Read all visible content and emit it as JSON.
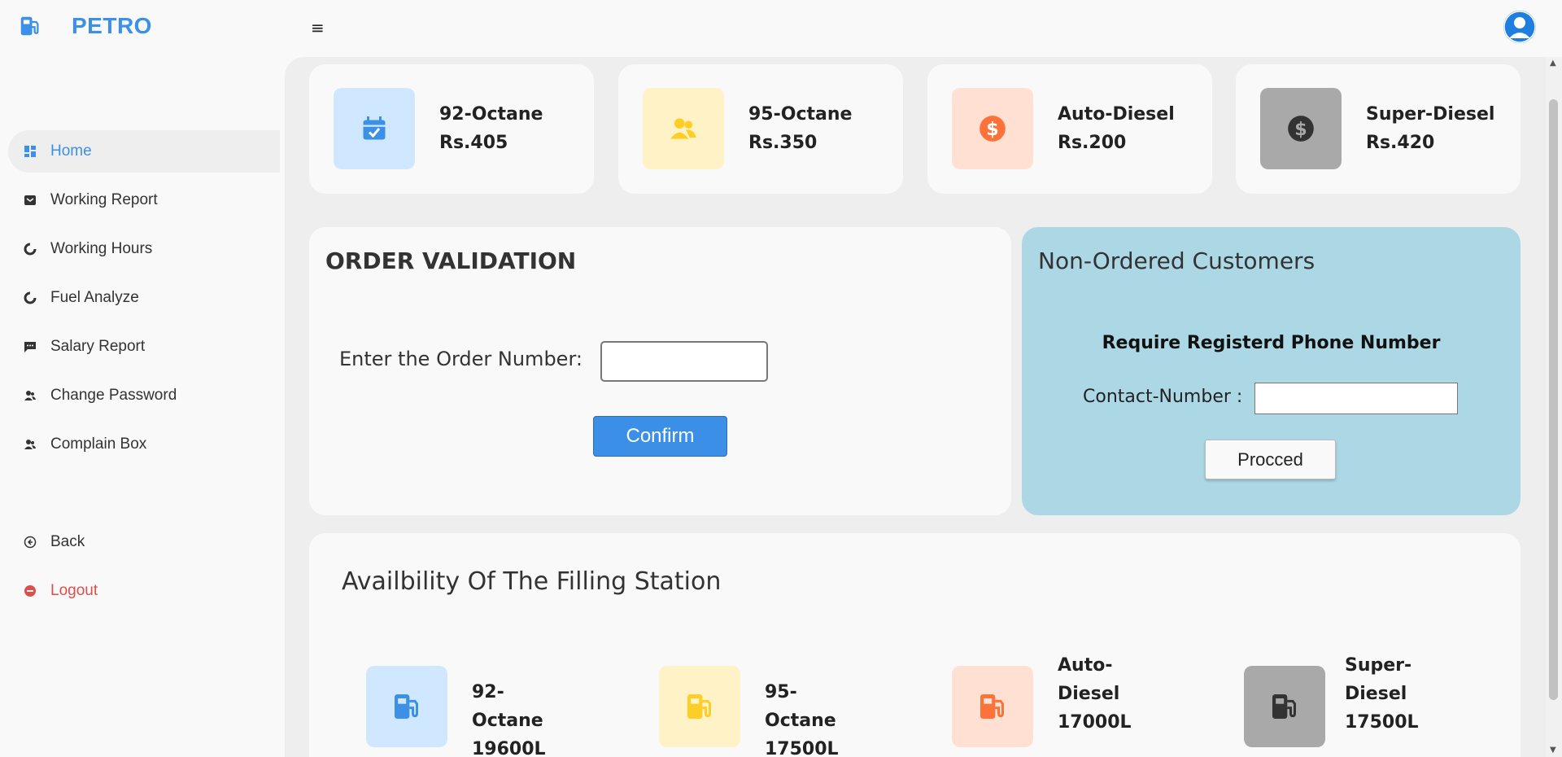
{
  "brand": {
    "name": "PETRO",
    "color": "#3c91e6"
  },
  "header": {
    "menu_icon": "hamburger-icon",
    "avatar_icon": "user-avatar-icon"
  },
  "sidebar": {
    "items": [
      {
        "label": "Home",
        "icon": "dashboard-icon",
        "active": true
      },
      {
        "label": "Working Report",
        "icon": "inbox-icon"
      },
      {
        "label": "Working Hours",
        "icon": "pie-chart-icon"
      },
      {
        "label": "Fuel Analyze",
        "icon": "pie-chart-icon"
      },
      {
        "label": "Salary Report",
        "icon": "message-icon"
      },
      {
        "label": "Change Password",
        "icon": "user-group-icon"
      },
      {
        "label": "Complain Box",
        "icon": "user-group-icon"
      }
    ],
    "back": {
      "label": "Back",
      "icon": "arrow-left-circle-icon"
    },
    "logout": {
      "label": "Logout",
      "icon": "logout-icon",
      "color": "#db504a"
    }
  },
  "prices": [
    {
      "name": "92-Octane",
      "price": "Rs.405",
      "icon": "calendar-check-icon",
      "bg": "#cfe8ff",
      "fg": "#3c91e6"
    },
    {
      "name": "95-Octane",
      "price": "Rs.350",
      "icon": "group-icon",
      "bg": "#fff2c6",
      "fg": "#ffce26"
    },
    {
      "name": "Auto-Diesel",
      "price": "Rs.200",
      "icon": "dollar-circle-icon",
      "bg": "#ffe0d3",
      "fg": "#fd7238"
    },
    {
      "name": "Super-Diesel",
      "price": "Rs.420",
      "icon": "dollar-circle-icon",
      "bg": "#a9a9a9",
      "fg": "#333333"
    }
  ],
  "order_validation": {
    "title": "ORDER VALIDATION",
    "label": "Enter the Order Number:",
    "input_value": "",
    "confirm_label": "Confirm"
  },
  "non_ordered": {
    "title": "Non-Ordered Customers",
    "subtitle": "Require Registerd Phone Number",
    "contact_label": "Contact-Number :",
    "input_value": "",
    "procced_label": "Procced",
    "bg": "#acd8e6"
  },
  "availability": {
    "title": "Availbility Of The Filling Station",
    "items": [
      {
        "name": "92-Octane",
        "amount": "19600L",
        "icon": "gas-pump-icon",
        "bg": "#cfe8ff",
        "fg": "#3c91e6"
      },
      {
        "name": "95-Octane",
        "amount": "17500L",
        "icon": "gas-pump-icon",
        "bg": "#fff2c6",
        "fg": "#ffce26"
      },
      {
        "name_line1": "Auto-",
        "name_line2": "Diesel",
        "amount": "17000L",
        "icon": "gas-pump-icon",
        "bg": "#ffe0d3",
        "fg": "#fd7238"
      },
      {
        "name_line1": "Super-",
        "name_line2": "Diesel",
        "amount": "17500L",
        "icon": "gas-pump-icon",
        "bg": "#a9a9a9",
        "fg": "#333333"
      }
    ]
  }
}
